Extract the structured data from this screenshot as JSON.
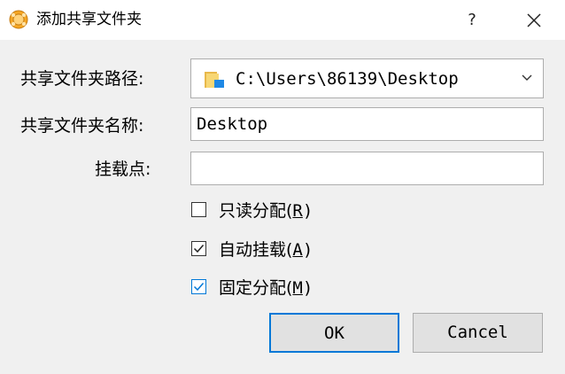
{
  "window": {
    "title": "添加共享文件夹",
    "help_label": "?",
    "icons": {
      "app": "virtualbox-cube-icon",
      "close": "close-icon"
    }
  },
  "form": {
    "path_label": "共享文件夹路径:",
    "path_value": "C:\\Users\\86139\\Desktop",
    "name_label": "共享文件夹名称:",
    "name_value": "Desktop",
    "mount_label": "挂载点:",
    "mount_value": ""
  },
  "options": {
    "readonly": {
      "label": "只读分配(",
      "key": "R",
      "suffix": ")",
      "checked": false
    },
    "automount": {
      "label": "自动挂载(",
      "key": "A",
      "suffix": ")",
      "checked": true
    },
    "permanent": {
      "label": "固定分配(",
      "key": "M",
      "suffix": ")",
      "checked": true
    }
  },
  "buttons": {
    "ok": "OK",
    "cancel": "Cancel"
  },
  "colors": {
    "accent": "#0078d7",
    "background": "#f0f0f0"
  }
}
